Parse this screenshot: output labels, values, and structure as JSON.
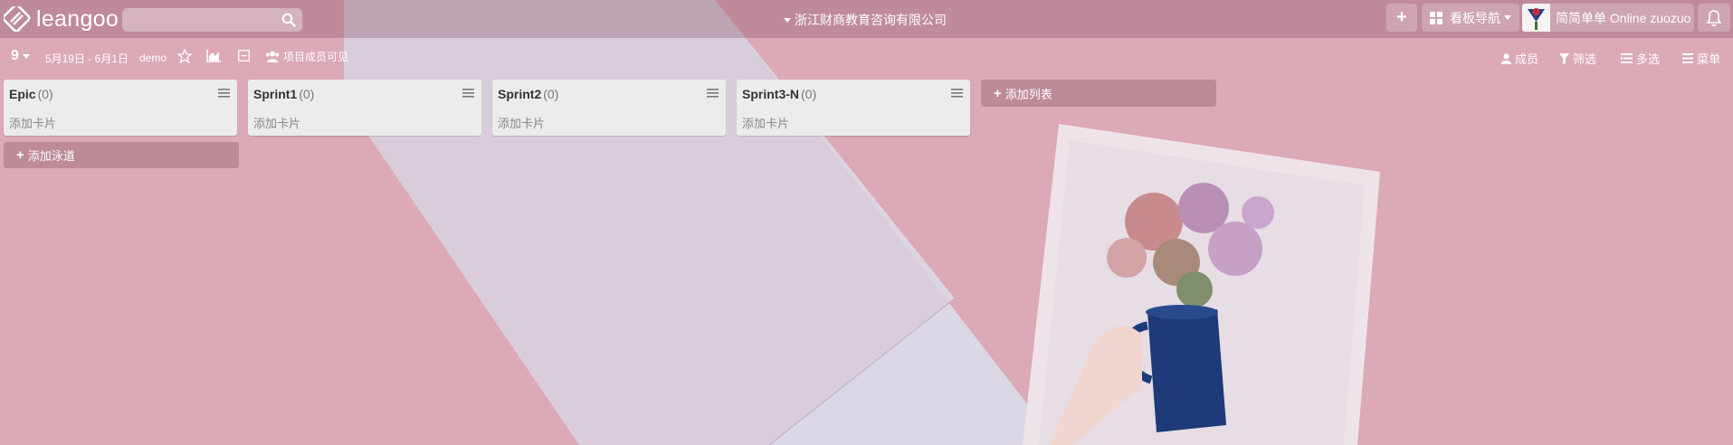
{
  "app": {
    "logo_text": "leangoo",
    "company": "浙江财商教育咨询有限公司",
    "search": {
      "value": "",
      "placeholder": ""
    }
  },
  "toolbar": {
    "add_label": "+",
    "nav_label": "看板导航",
    "user_label": "简简单单 Online zuozuo"
  },
  "board": {
    "number": "9",
    "date_range": "5月19日 - 6月1日",
    "name": "demo",
    "visibility": "项目成员可见",
    "actions": {
      "members": "成员",
      "filter": "筛选",
      "multi_select": "多选",
      "menu": "菜单"
    }
  },
  "lists": [
    {
      "title": "Epic",
      "count": "(0)",
      "add_card": "添加卡片"
    },
    {
      "title": "Sprint1",
      "count": "(0)",
      "add_card": "添加卡片"
    },
    {
      "title": "Sprint2",
      "count": "(0)",
      "add_card": "添加卡片"
    },
    {
      "title": "Sprint3-N",
      "count": "(0)",
      "add_card": "添加卡片"
    }
  ],
  "add_list_label": "添加列表",
  "add_lane_label": "添加泳道",
  "icons": {
    "logo": "leangoo-logo-icon",
    "search": "search-icon",
    "star": "star-icon",
    "chart": "area-chart-icon",
    "collapse": "collapse-icon",
    "group": "group-icon",
    "user": "user-icon",
    "filter": "filter-icon",
    "multi": "multi-select-icon",
    "menu": "hamburger-icon",
    "bell": "bell-icon",
    "grid": "grid-icon"
  },
  "colors": {
    "background": "#dba9b6",
    "list_bg": "#ececec",
    "topbar": "#b87f90"
  }
}
